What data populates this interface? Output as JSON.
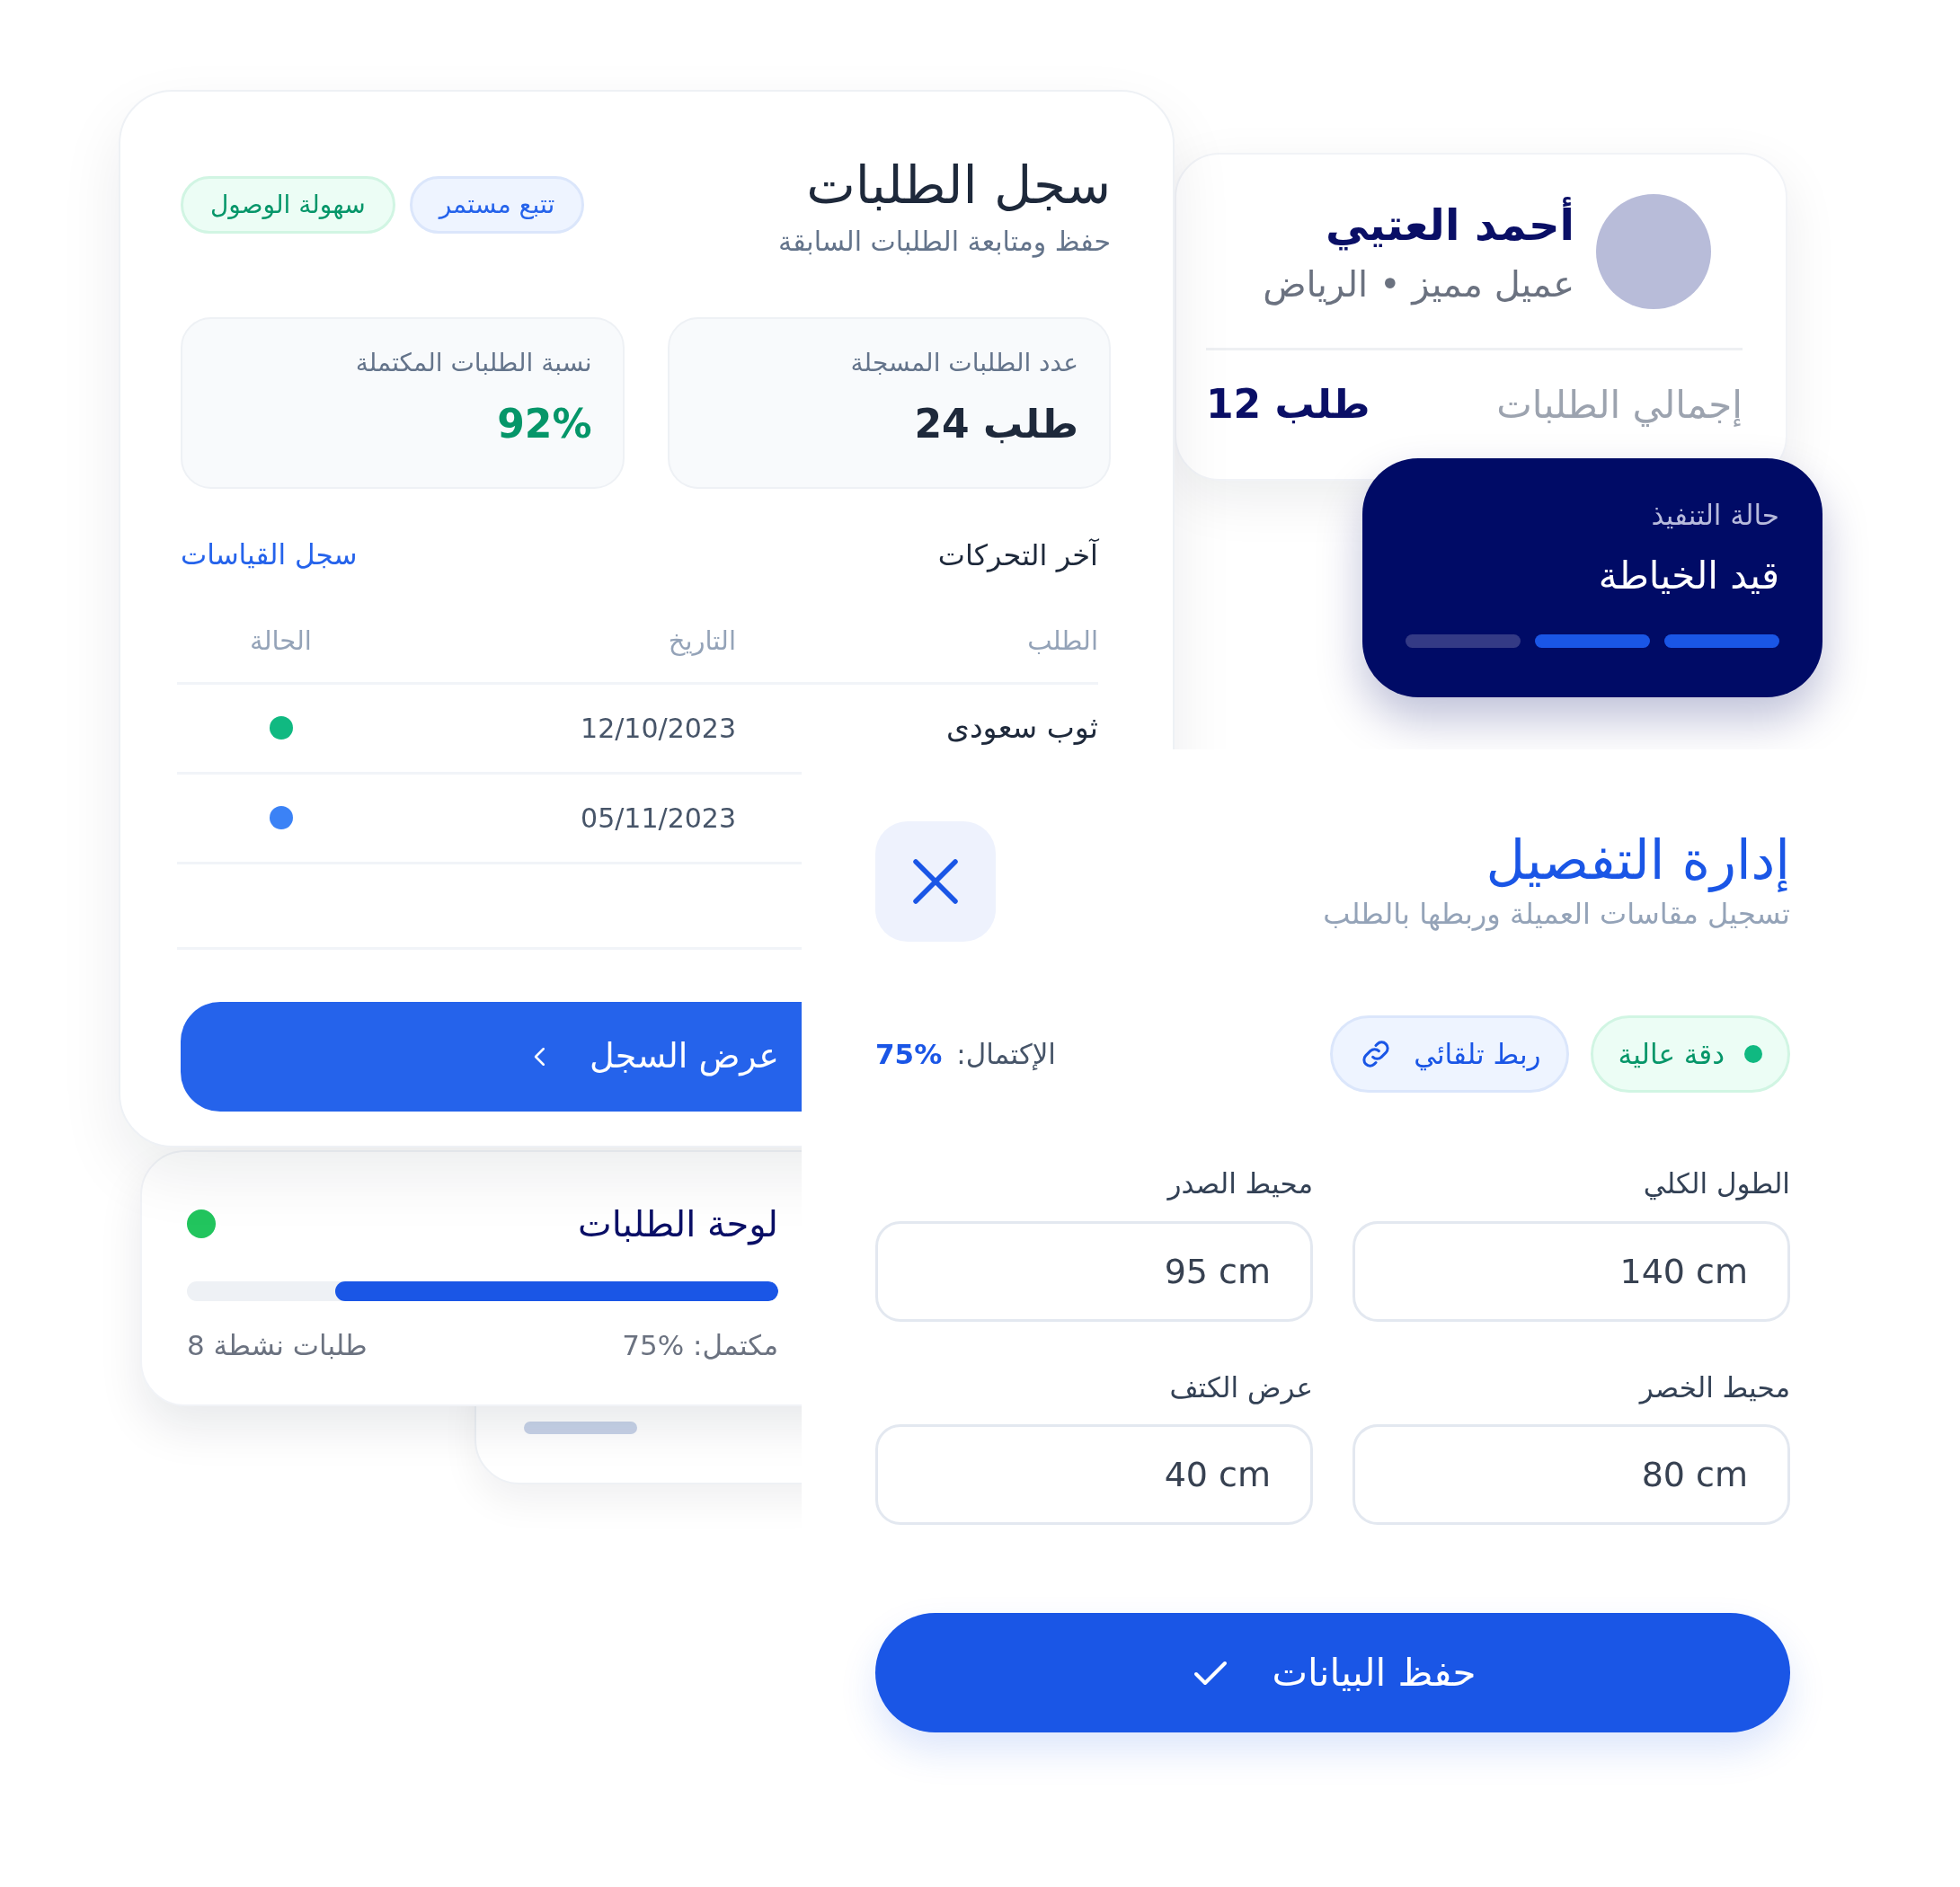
{
  "orders_card": {
    "title": "سجل الطلبات",
    "subtitle": "حفظ ومتابعة الطلبات السابقة",
    "tags": [
      {
        "label": "تتبع مستمر",
        "kind": "info"
      },
      {
        "label": "سهولة الوصول",
        "kind": "success"
      }
    ],
    "stats": [
      {
        "label": "عدد الطلبات المسجلة",
        "value": "24 طلب",
        "kind": "count"
      },
      {
        "label": "نسبة الطلبات المكتملة",
        "value": "92%",
        "kind": "percent"
      }
    ],
    "section_title": "آخر التحركات",
    "section_link": "سجل القياسات",
    "table": {
      "columns": [
        "الطلب",
        "التاريخ",
        "الحالة"
      ],
      "rows": [
        {
          "order": "ثوب سعودى",
          "date": "12/10/2023",
          "color": "#10b981"
        },
        {
          "date": "05/11/2023",
          "color": "#3b82f6"
        }
      ]
    },
    "button": "عرض السجل"
  },
  "profile_card": {
    "name": "أحمد العتيي",
    "subtitle": "عميل مميز • الرياض",
    "total_label": "إجمالي الطلبات",
    "total_value": "12 طلب"
  },
  "status_card": {
    "label": "حالة التنفيذ",
    "value": "قيد الخياطة",
    "steps": [
      {
        "done": true
      },
      {
        "done": true
      },
      {
        "done": false
      }
    ]
  },
  "dashboard_card": {
    "title": "لوحة الطلبات",
    "level": 0.75,
    "completed": "مكتمل: %75",
    "active": "8 طلبات نشطة"
  },
  "form_panel": {
    "title": "إدارة التفصيل",
    "subtitle": "تسجيل مقاسات العميلة وربطها بالطلب",
    "chips": [
      {
        "label": "دقة عالية",
        "kind": "status"
      },
      {
        "label": "ربط تلقائي",
        "kind": "link"
      }
    ],
    "completion_label": "الإكتمال:",
    "completion_value": "75%",
    "fields": [
      {
        "label": "الطول الكلي",
        "value": "140 cm"
      },
      {
        "label": "محيط الصدر",
        "value": "95 cm"
      },
      {
        "label": "محيط الخصر",
        "value": "80 cm"
      },
      {
        "label": "عرض الكتف",
        "value": "40 cm"
      }
    ],
    "save_button": "حفظ البيانات"
  }
}
